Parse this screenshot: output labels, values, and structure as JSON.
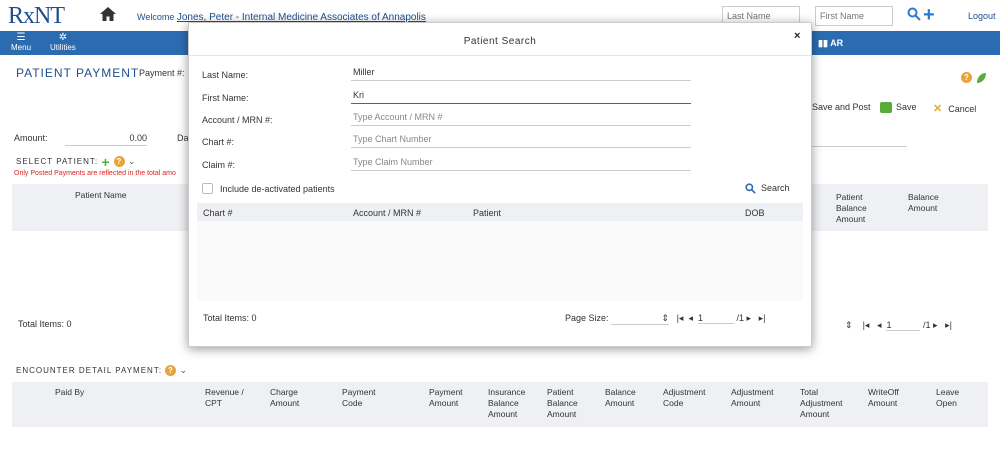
{
  "header": {
    "logo": "RxNT",
    "logo_mark": "®",
    "welcome_prefix": "Welcome",
    "user": "Jones, Peter - Internal Medicine Associates of Annapolis",
    "last_name_placeholder": "Last Name",
    "first_name_placeholder": "First Name",
    "logout": "Logout"
  },
  "nav": {
    "menu": "Menu",
    "utilities": "Utilities",
    "ar": "AR"
  },
  "page": {
    "title": "PATIENT PAYMENT",
    "payment_label": "Payment #:",
    "save_and_post": "Save and Post",
    "save": "Save",
    "cancel": "Cancel",
    "amount_label": "Amount:",
    "amount_value": "0.00",
    "date_label": "Da",
    "select_patient": "SELECT PATIENT:",
    "note": "Only Posted Payments are reflected in the total amo"
  },
  "patient_grid": {
    "col_name": "Patient Name",
    "col_pat_balance": "Patient Balance Amount",
    "col_balance": "Balance Amount",
    "total_items": "Total Items: 0",
    "page": "1",
    "of": "/1"
  },
  "encounter": {
    "title": "ENCOUNTER DETAIL PAYMENT:",
    "columns": [
      "Paid By",
      "Revenue / CPT",
      "Charge Amount",
      "Payment Code",
      "Payment Amount",
      "Insurance Balance Amount",
      "Patient Balance Amount",
      "Balance Amount",
      "Adjustment Code",
      "Adjustment Amount",
      "Total Adjustment Amount",
      "WriteOff Amount",
      "Leave Open"
    ]
  },
  "modal": {
    "title": "Patient Search",
    "close": "×",
    "last_name_label": "Last Name:",
    "last_name_value": "Miller",
    "first_name_label": "First Name:",
    "first_name_value": "Kri",
    "account_label": "Account / MRN #:",
    "account_placeholder": "Type Account / MRN #",
    "chart_label": "Chart #:",
    "chart_placeholder": "Type Chart Number",
    "claim_label": "Claim #:",
    "claim_placeholder": "Type Claim Number",
    "include_deactivated": "Include de-activated patients",
    "search": "Search",
    "grid_cols": [
      "Chart #",
      "Account / MRN #",
      "Patient",
      "DOB"
    ],
    "total_items": "Total Items: 0",
    "page_size_label": "Page Size:",
    "page": "1",
    "of": "/1"
  },
  "colors": {
    "brand": "#1f4e8c",
    "nav": "#2b6cb0",
    "accent": "#e8a33c",
    "green": "#5aaa3c"
  }
}
